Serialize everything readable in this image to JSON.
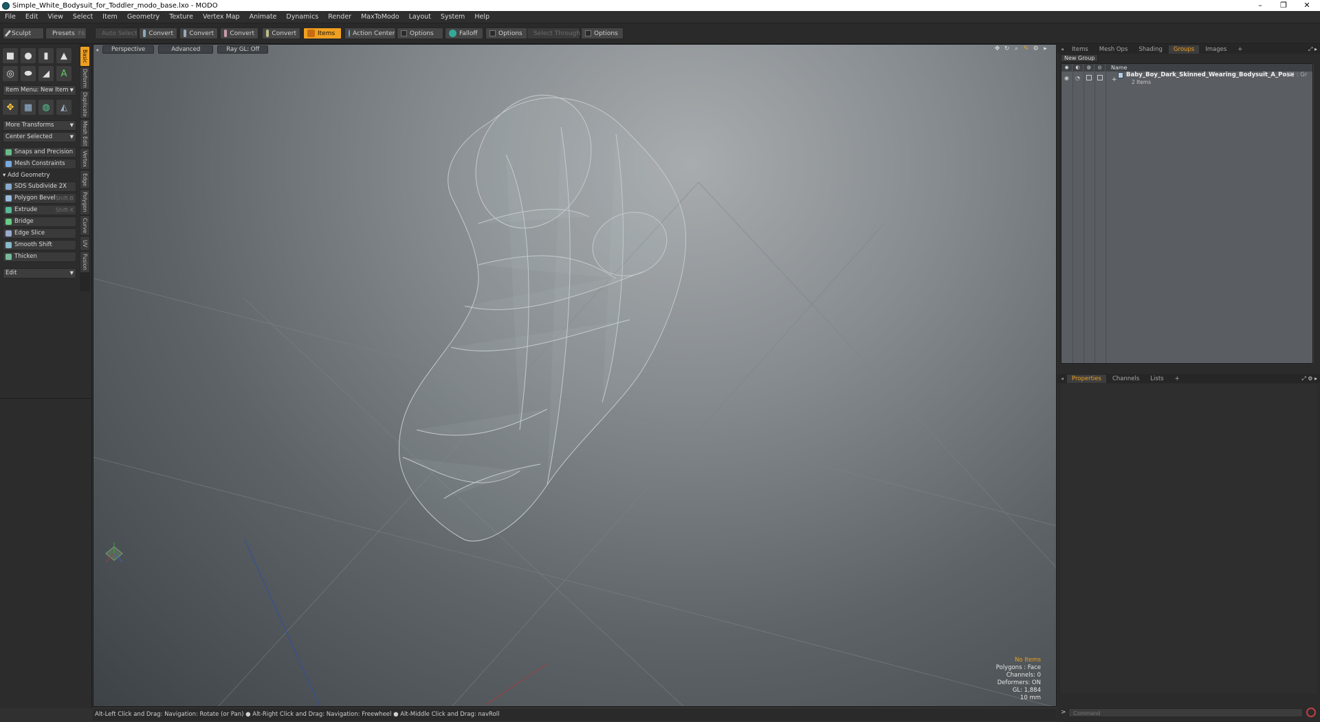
{
  "window": {
    "title": "Simple_White_Bodysuit_for_Toddler_modo_base.lxo - MODO",
    "minimize": "–",
    "maximize": "❐",
    "close": "✕"
  },
  "menu": [
    "File",
    "Edit",
    "View",
    "Select",
    "Item",
    "Geometry",
    "Texture",
    "Vertex Map",
    "Animate",
    "Dynamics",
    "Render",
    "MaxToModo",
    "Layout",
    "System",
    "Help"
  ],
  "toolbar": {
    "sculpt": "Sculpt",
    "presets": "Presets",
    "presets_key": "F6",
    "auto_select": "Auto Select",
    "convert": "Convert",
    "items": "Items",
    "action_center": "Action Center",
    "options": "Options",
    "falloff": "Falloff",
    "select_through": "Select Through"
  },
  "left": {
    "item_menu": "Item Menu: New Item",
    "more_transforms": "More Transforms",
    "center_selected": "Center Selected",
    "snaps": "Snaps and Precision",
    "mesh_constraints": "Mesh Constraints",
    "add_geometry": "Add Geometry",
    "tools": [
      {
        "label": "SDS Subdivide 2X",
        "shortcut": ""
      },
      {
        "label": "Polygon Bevel",
        "shortcut": "Shift-B"
      },
      {
        "label": "Extrude",
        "shortcut": "Shift-X"
      },
      {
        "label": "Bridge",
        "shortcut": ""
      },
      {
        "label": "Edge Slice",
        "shortcut": ""
      },
      {
        "label": "Smooth Shift",
        "shortcut": ""
      },
      {
        "label": "Thicken",
        "shortcut": ""
      }
    ],
    "edit": "Edit"
  },
  "sidetabs": [
    "Basic",
    "Deform",
    "Duplicate",
    "Mesh Edit",
    "Vertex",
    "Edge",
    "Polygon",
    "Curve",
    "UV",
    "Fusion"
  ],
  "viewport": {
    "perspective": "Perspective",
    "advanced": "Advanced",
    "raygl": "Ray GL: Off",
    "info": {
      "no_items": "No Items",
      "polygons": "Polygons : Face",
      "channels": "Channels: 0",
      "deformers": "Deformers: ON",
      "gl": "GL: 1,884",
      "scale": "10 mm"
    }
  },
  "status": "Alt-Left Click and Drag: Navigation: Rotate (or Pan) ● Alt-Right Click and Drag: Navigation: Freewheel ● Alt-Middle Click and Drag: navRoll",
  "right": {
    "tabs": [
      "Items",
      "Mesh Ops",
      "Shading",
      "Groups",
      "Images"
    ],
    "new_group": "New Group",
    "name_header": "Name",
    "group_name": "Baby_Boy_Dark_Skinned_Wearing_Bodysuit_A_Pose",
    "group_count": "(2) : Gr",
    "group_sub": "2 Items",
    "bottom_tabs": [
      "Properties",
      "Channels",
      "Lists"
    ],
    "command_placeholder": "Command"
  },
  "colors": {
    "accent": "#f0a020"
  }
}
